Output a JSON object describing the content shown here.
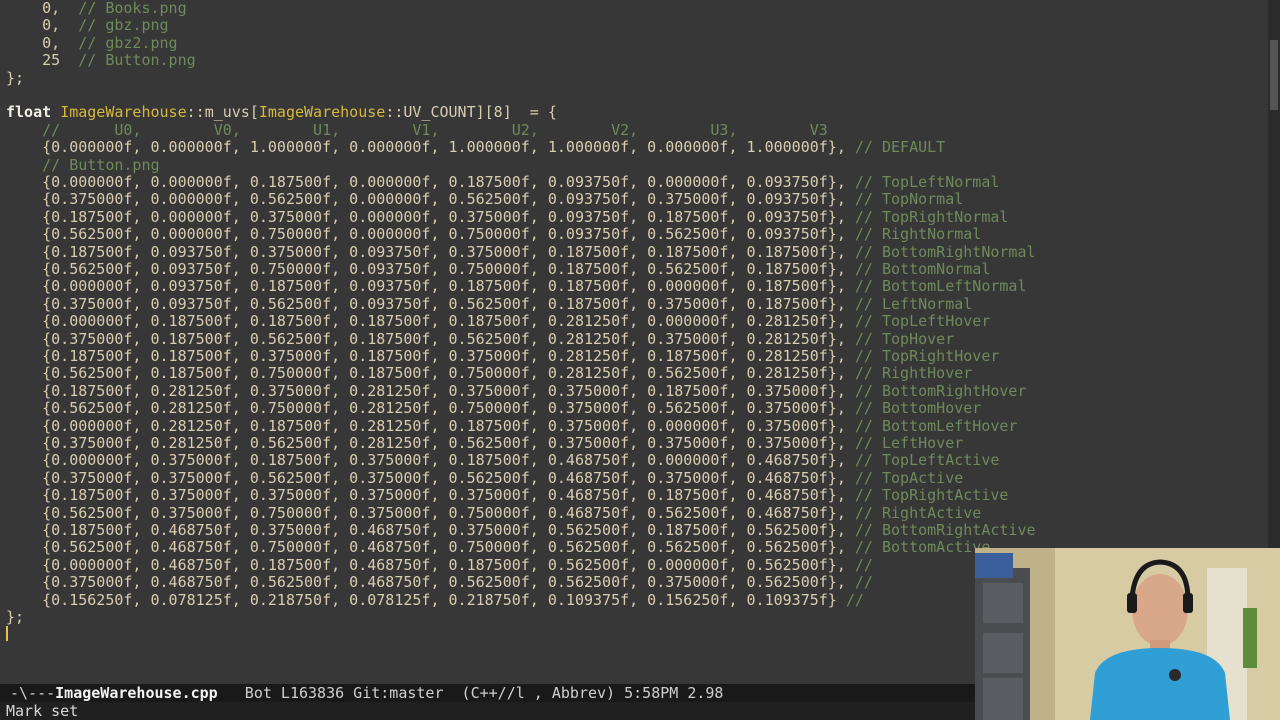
{
  "editor": {
    "lines": [
      {
        "indent": "    ",
        "value": "0,",
        "comment": "  // Books.png"
      },
      {
        "indent": "    ",
        "value": "0,",
        "comment": "  // gbz.png"
      },
      {
        "indent": "    ",
        "value": "0,",
        "comment": "  // gbz2.png"
      },
      {
        "indent": "    ",
        "value": "25",
        "comment": "  // Button.png"
      },
      {
        "indent": "",
        "value": "};",
        "comment": ""
      },
      {
        "indent": "",
        "value": "",
        "comment": ""
      },
      {
        "decl": {
          "kw": "float",
          "cls1": "ImageWarehouse",
          "sep1": "::",
          "member": "m_uvs[",
          "cls2": "ImageWarehouse",
          "sep2": "::",
          "rest": "UV_COUNT][8]  = {"
        }
      },
      {
        "indent": "    ",
        "value": "",
        "comment": "//      U0,        V0,        U1,        V1,        U2,        V2,        U3,        V3"
      },
      {
        "indent": "    ",
        "value": "{0.000000f, 0.000000f, 1.000000f, 0.000000f, 1.000000f, 1.000000f, 0.000000f, 1.000000f},",
        "comment": " // DEFAULT"
      },
      {
        "indent": "    ",
        "value": "",
        "comment": "// Button.png"
      },
      {
        "indent": "    ",
        "value": "{0.000000f, 0.000000f, 0.187500f, 0.000000f, 0.187500f, 0.093750f, 0.000000f, 0.093750f},",
        "comment": " // TopLeftNormal"
      },
      {
        "indent": "    ",
        "value": "{0.375000f, 0.000000f, 0.562500f, 0.000000f, 0.562500f, 0.093750f, 0.375000f, 0.093750f},",
        "comment": " // TopNormal"
      },
      {
        "indent": "    ",
        "value": "{0.187500f, 0.000000f, 0.375000f, 0.000000f, 0.375000f, 0.093750f, 0.187500f, 0.093750f},",
        "comment": " // TopRightNormal"
      },
      {
        "indent": "    ",
        "value": "{0.562500f, 0.000000f, 0.750000f, 0.000000f, 0.750000f, 0.093750f, 0.562500f, 0.093750f},",
        "comment": " // RightNormal"
      },
      {
        "indent": "    ",
        "value": "{0.187500f, 0.093750f, 0.375000f, 0.093750f, 0.375000f, 0.187500f, 0.187500f, 0.187500f},",
        "comment": " // BottomRightNormal"
      },
      {
        "indent": "    ",
        "value": "{0.562500f, 0.093750f, 0.750000f, 0.093750f, 0.750000f, 0.187500f, 0.562500f, 0.187500f},",
        "comment": " // BottomNormal"
      },
      {
        "indent": "    ",
        "value": "{0.000000f, 0.093750f, 0.187500f, 0.093750f, 0.187500f, 0.187500f, 0.000000f, 0.187500f},",
        "comment": " // BottomLeftNormal"
      },
      {
        "indent": "    ",
        "value": "{0.375000f, 0.093750f, 0.562500f, 0.093750f, 0.562500f, 0.187500f, 0.375000f, 0.187500f},",
        "comment": " // LeftNormal"
      },
      {
        "indent": "    ",
        "value": "{0.000000f, 0.187500f, 0.187500f, 0.187500f, 0.187500f, 0.281250f, 0.000000f, 0.281250f},",
        "comment": " // TopLeftHover"
      },
      {
        "indent": "    ",
        "value": "{0.375000f, 0.187500f, 0.562500f, 0.187500f, 0.562500f, 0.281250f, 0.375000f, 0.281250f},",
        "comment": " // TopHover"
      },
      {
        "indent": "    ",
        "value": "{0.187500f, 0.187500f, 0.375000f, 0.187500f, 0.375000f, 0.281250f, 0.187500f, 0.281250f},",
        "comment": " // TopRightHover"
      },
      {
        "indent": "    ",
        "value": "{0.562500f, 0.187500f, 0.750000f, 0.187500f, 0.750000f, 0.281250f, 0.562500f, 0.281250f},",
        "comment": " // RightHover"
      },
      {
        "indent": "    ",
        "value": "{0.187500f, 0.281250f, 0.375000f, 0.281250f, 0.375000f, 0.375000f, 0.187500f, 0.375000f},",
        "comment": " // BottomRightHover"
      },
      {
        "indent": "    ",
        "value": "{0.562500f, 0.281250f, 0.750000f, 0.281250f, 0.750000f, 0.375000f, 0.562500f, 0.375000f},",
        "comment": " // BottomHover"
      },
      {
        "indent": "    ",
        "value": "{0.000000f, 0.281250f, 0.187500f, 0.281250f, 0.187500f, 0.375000f, 0.000000f, 0.375000f},",
        "comment": " // BottomLeftHover"
      },
      {
        "indent": "    ",
        "value": "{0.375000f, 0.281250f, 0.562500f, 0.281250f, 0.562500f, 0.375000f, 0.375000f, 0.375000f},",
        "comment": " // LeftHover"
      },
      {
        "indent": "    ",
        "value": "{0.000000f, 0.375000f, 0.187500f, 0.375000f, 0.187500f, 0.468750f, 0.000000f, 0.468750f},",
        "comment": " // TopLeftActive"
      },
      {
        "indent": "    ",
        "value": "{0.375000f, 0.375000f, 0.562500f, 0.375000f, 0.562500f, 0.468750f, 0.375000f, 0.468750f},",
        "comment": " // TopActive"
      },
      {
        "indent": "    ",
        "value": "{0.187500f, 0.375000f, 0.375000f, 0.375000f, 0.375000f, 0.468750f, 0.187500f, 0.468750f},",
        "comment": " // TopRightActive"
      },
      {
        "indent": "    ",
        "value": "{0.562500f, 0.375000f, 0.750000f, 0.375000f, 0.750000f, 0.468750f, 0.562500f, 0.468750f},",
        "comment": " // RightActive"
      },
      {
        "indent": "    ",
        "value": "{0.187500f, 0.468750f, 0.375000f, 0.468750f, 0.375000f, 0.562500f, 0.187500f, 0.562500f},",
        "comment": " // BottomRightActive"
      },
      {
        "indent": "    ",
        "value": "{0.562500f, 0.468750f, 0.750000f, 0.468750f, 0.750000f, 0.562500f, 0.562500f, 0.562500f},",
        "comment": " // BottomActive"
      },
      {
        "indent": "    ",
        "value": "{0.000000f, 0.468750f, 0.187500f, 0.468750f, 0.187500f, 0.562500f, 0.000000f, 0.562500f},",
        "comment": " //"
      },
      {
        "indent": "    ",
        "value": "{0.375000f, 0.468750f, 0.562500f, 0.468750f, 0.562500f, 0.562500f, 0.375000f, 0.562500f},",
        "comment": " //"
      },
      {
        "indent": "    ",
        "value": "{0.156250f, 0.078125f, 0.218750f, 0.078125f, 0.218750f, 0.109375f, 0.156250f, 0.109375f}",
        "comment": " //"
      },
      {
        "indent": "",
        "value": "};",
        "comment": ""
      }
    ]
  },
  "modeline": {
    "prefix": "-\\---",
    "filename": "ImageWarehouse.cpp",
    "rest": "   Bot L163836 Git:master  (C++//l , Abbrev) 5:58PM 2.98"
  },
  "minibuffer": {
    "message": "Mark set"
  },
  "colors": {
    "background": "#373737",
    "text": "#d8cdb0",
    "comment": "#6f8a5a",
    "type": "#d6b73f",
    "keyword": "#f0eee6",
    "modeline_bg": "#191919"
  }
}
